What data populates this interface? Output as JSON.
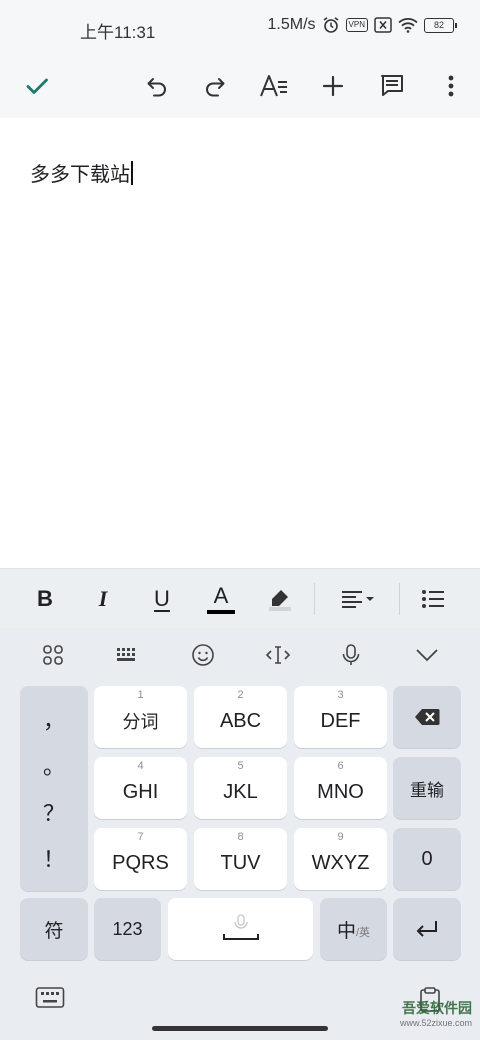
{
  "status_bar": {
    "time": "上午11:31",
    "speed": "1.5M/s",
    "vpn_label": "VPN",
    "battery": "82"
  },
  "toolbar": {
    "icons": [
      "check-icon",
      "undo-icon",
      "redo-icon",
      "text-format-icon",
      "add-icon",
      "comment-icon",
      "more-vert-icon"
    ]
  },
  "editor": {
    "text": "多多下载站"
  },
  "format_bar": {
    "bold_label": "B",
    "italic_label": "I",
    "underline_label": "U",
    "text_color_label": "A",
    "text_color_underline": "#000000"
  },
  "keyboard": {
    "top_icons": [
      "apps-grid-icon",
      "keyboard-icon",
      "emoji-icon",
      "cursor-move-icon",
      "microphone-icon",
      "chevron-down-icon"
    ],
    "punctuation": [
      "，",
      "。",
      "？",
      "！"
    ],
    "keys": {
      "k1": {
        "num": "1",
        "label": "分词"
      },
      "k2": {
        "num": "2",
        "label": "ABC"
      },
      "k3": {
        "num": "3",
        "label": "DEF"
      },
      "k4": {
        "num": "4",
        "label": "GHI"
      },
      "k5": {
        "num": "5",
        "label": "JKL"
      },
      "k6": {
        "num": "6",
        "label": "MNO"
      },
      "k7": {
        "num": "7",
        "label": "PQRS"
      },
      "k8": {
        "num": "8",
        "label": "TUV"
      },
      "k9": {
        "num": "9",
        "label": "WXYZ"
      }
    },
    "retype_label": "重输",
    "zero_label": "0",
    "symbol_label": "符",
    "num_label": "123",
    "lang_main": "中",
    "lang_sub": "/英"
  },
  "watermark": {
    "title": "吾爱软件园",
    "url": "www.52zixue.com"
  },
  "colors": {
    "accent": "#1a7a6e",
    "keyboard_bg": "#e9ecf1",
    "key_bg": "#ffffff",
    "fn_key_bg": "#d5dae2"
  }
}
